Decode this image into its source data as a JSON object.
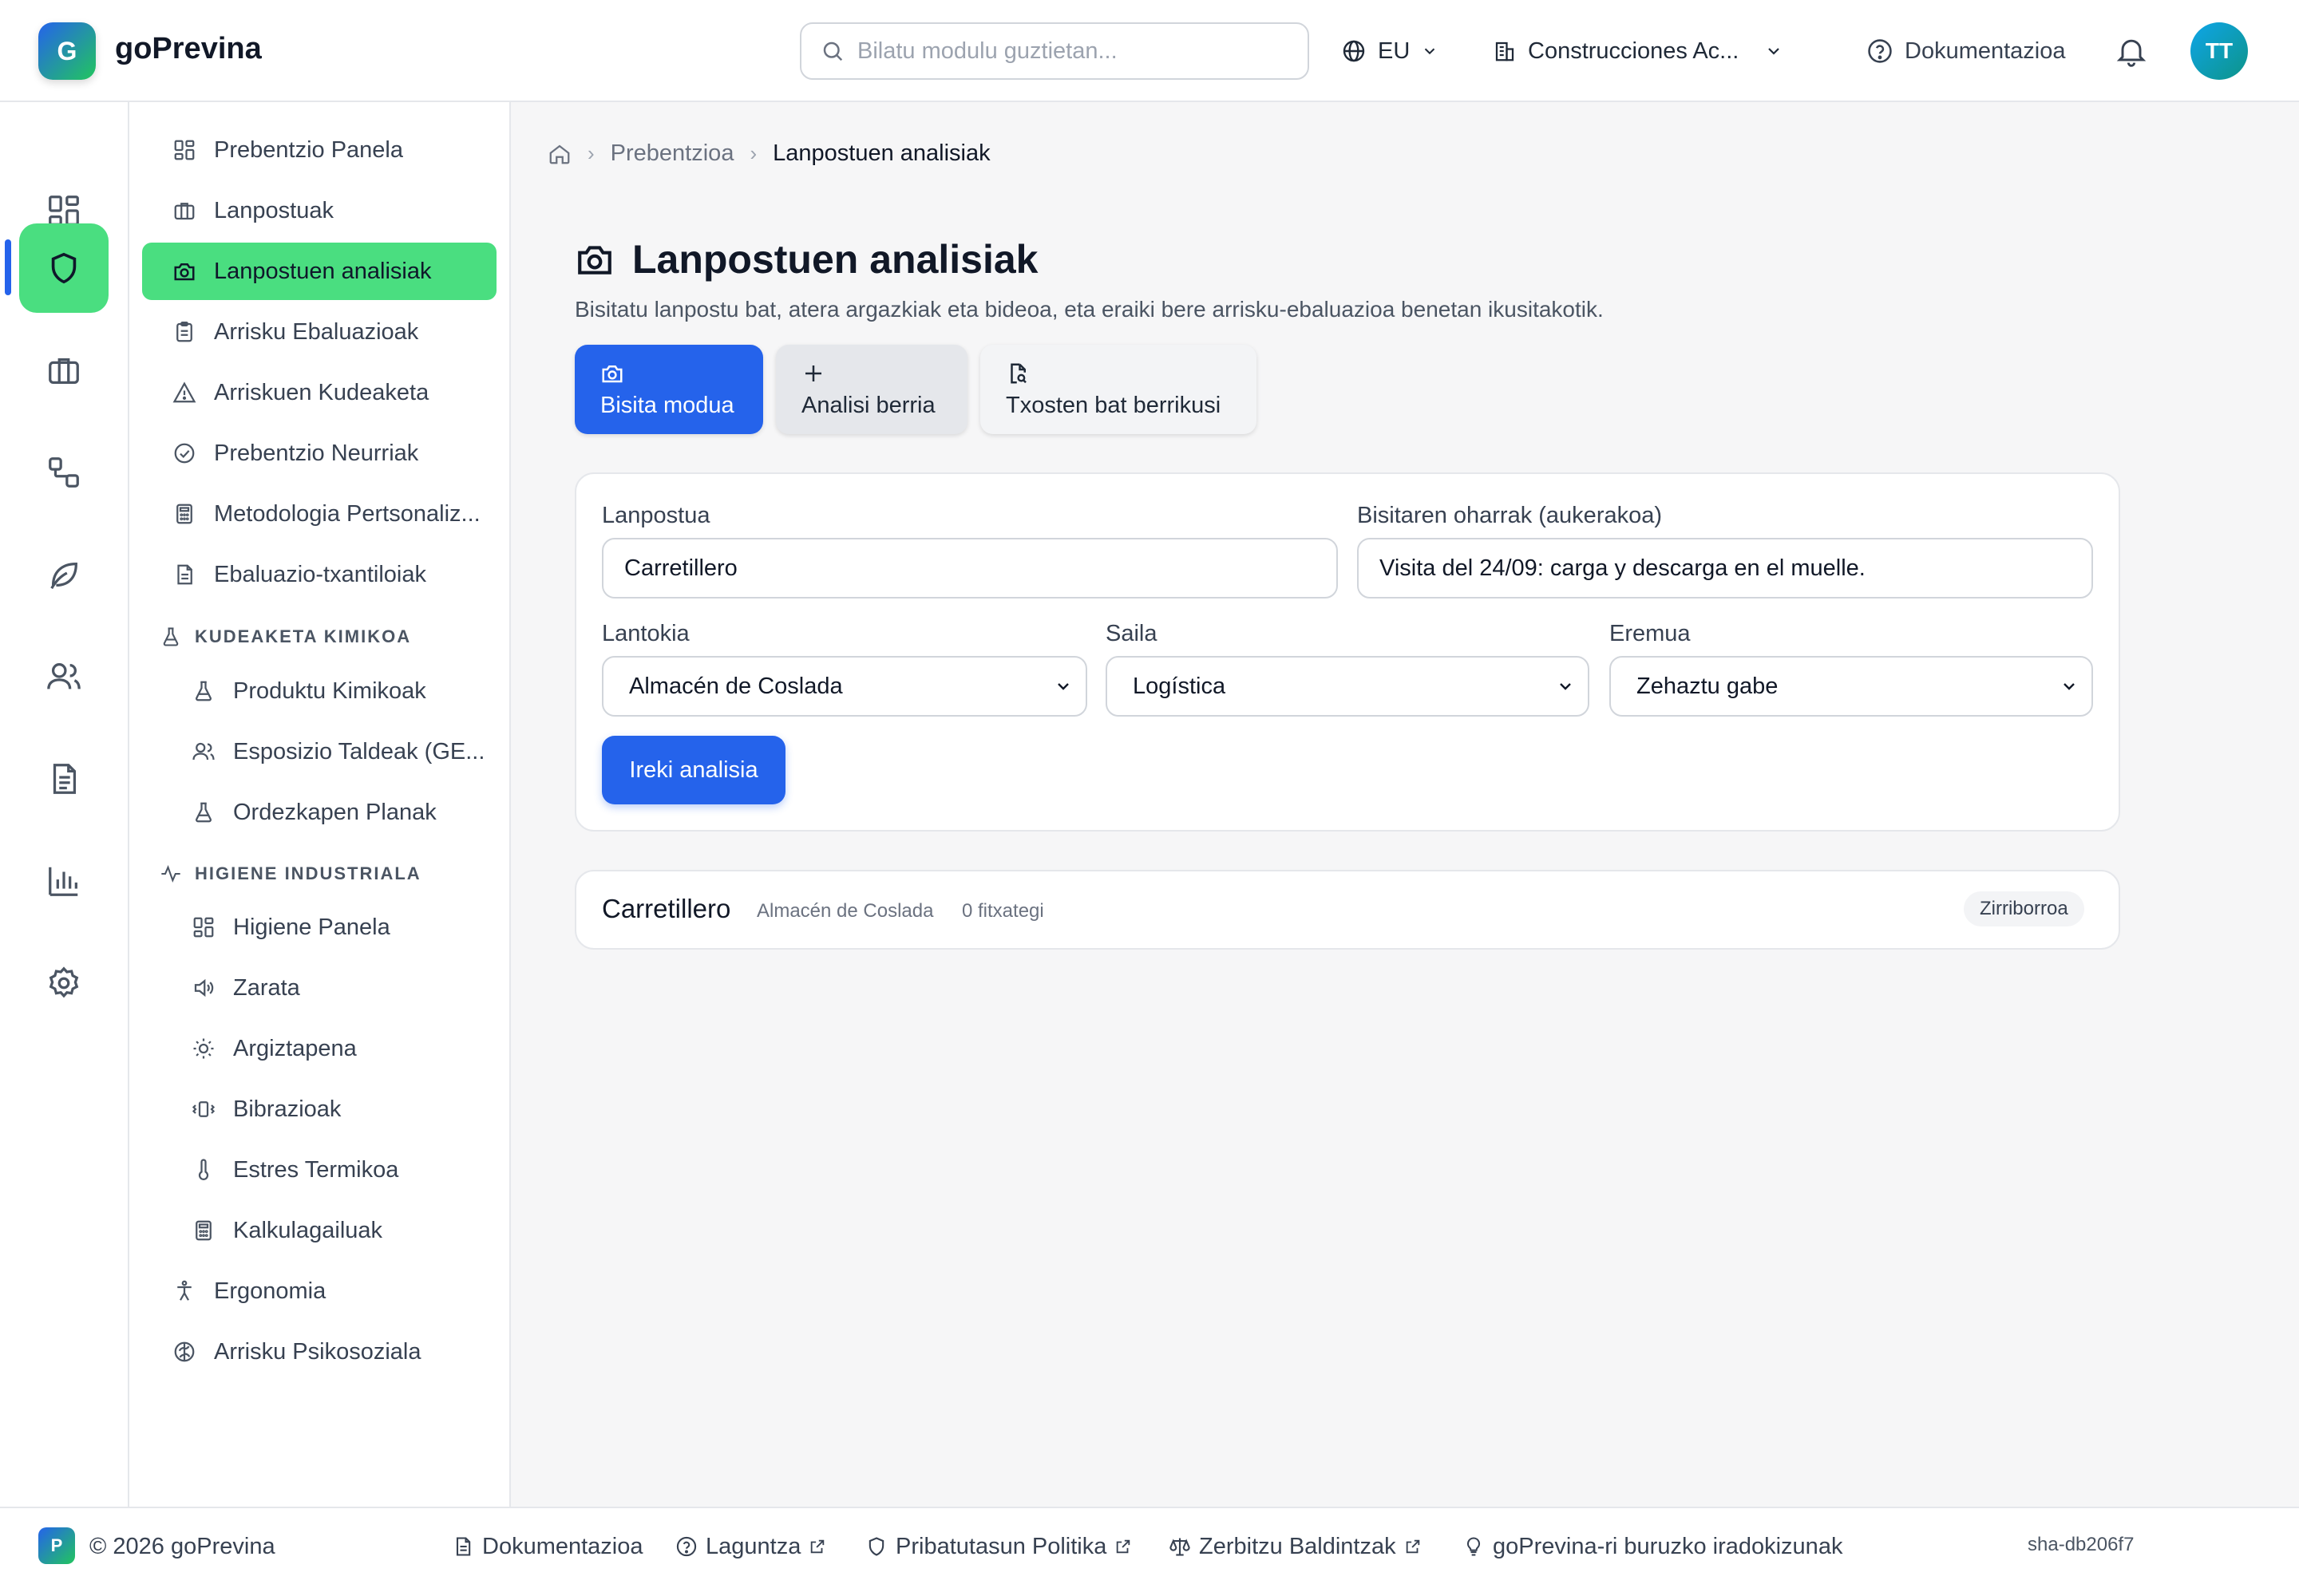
{
  "app": {
    "logo_letter": "G",
    "name": "goPrevina"
  },
  "header": {
    "search_placeholder": "Bilatu modulu guztietan...",
    "language": "EU",
    "company": "Construcciones Ac...",
    "docs": "Dokumentazioa",
    "avatar_initials": "TT"
  },
  "rail": {
    "items": [
      {
        "icon": "dashboard-icon"
      },
      {
        "icon": "shield-icon",
        "active": true
      },
      {
        "icon": "briefcase-icon"
      },
      {
        "icon": "workflow-icon"
      },
      {
        "icon": "leaf-icon"
      },
      {
        "icon": "users-icon"
      },
      {
        "icon": "document-icon"
      },
      {
        "icon": "bar-chart-icon"
      },
      {
        "icon": "gear-icon"
      }
    ]
  },
  "sidebar": {
    "items": [
      {
        "label": "Prebentzio Panela",
        "icon": "dashboard-icon"
      },
      {
        "label": "Lanpostuak",
        "icon": "briefcase-icon"
      },
      {
        "label": "Lanpostuen analisiak",
        "icon": "camera-icon",
        "active": true
      },
      {
        "label": "Arrisku Ebaluazioak",
        "icon": "clipboard-icon"
      },
      {
        "label": "Arriskuen Kudeaketa",
        "icon": "warning-icon"
      },
      {
        "label": "Prebentzio Neurriak",
        "icon": "check-circle-icon"
      },
      {
        "label": "Metodologia Pertsonaliz...",
        "icon": "calculator-icon"
      },
      {
        "label": "Ebaluazio-txantiloiak",
        "icon": "file-text-icon"
      }
    ],
    "section_chemical": {
      "title": "KUDEAKETA KIMIKOA",
      "items": [
        {
          "label": "Produktu Kimikoak",
          "icon": "flask-icon"
        },
        {
          "label": "Esposizio Taldeak (GE...",
          "icon": "users-icon"
        },
        {
          "label": "Ordezkapen Planak",
          "icon": "flask-icon"
        }
      ]
    },
    "section_hygiene": {
      "title": "HIGIENE INDUSTRIALA",
      "items": [
        {
          "label": "Higiene Panela",
          "icon": "dashboard-icon"
        },
        {
          "label": "Zarata",
          "icon": "speaker-icon"
        },
        {
          "label": "Argiztapena",
          "icon": "sun-icon"
        },
        {
          "label": "Bibrazioak",
          "icon": "vibration-icon"
        },
        {
          "label": "Estres Termikoa",
          "icon": "thermometer-icon"
        },
        {
          "label": "Kalkulagailuak",
          "icon": "calculator-icon"
        }
      ]
    },
    "bottom_items": [
      {
        "label": "Ergonomia",
        "icon": "person-icon"
      },
      {
        "label": "Arrisku Psikosoziala",
        "icon": "brain-icon"
      }
    ]
  },
  "breadcrumb": {
    "parent": "Prebentzioa",
    "current": "Lanpostuen analisiak"
  },
  "page": {
    "title": "Lanpostuen analisiak",
    "subtitle": "Bisitatu lanpostu bat, atera argazkiak eta bideoa, eta eraiki bere arrisku-ebaluazioa benetan ikusitakotik."
  },
  "tabs": [
    {
      "label": "Bisita modua",
      "icon": "camera-icon",
      "active": true
    },
    {
      "label": "Analisi berria",
      "icon": "plus-icon"
    },
    {
      "label": "Txosten bat berrikusi",
      "icon": "file-search-icon"
    }
  ],
  "form": {
    "lanpostua_label": "Lanpostua",
    "lanpostua_value": "Carretillero",
    "notes_label": "Bisitaren oharrak (aukerakoa)",
    "notes_value": "Visita del 24/09: carga y descarga en el muelle.",
    "lantokia_label": "Lantokia",
    "lantokia_value": "Almacén de Coslada",
    "saila_label": "Saila",
    "saila_value": "Logística",
    "eremua_label": "Eremua",
    "eremua_value": "Zehaztu gabe",
    "submit": "Ireki analisia"
  },
  "result": {
    "title": "Carretillero",
    "location": "Almacén de Coslada",
    "files": "0 fitxategi",
    "status": "Zirriborroa"
  },
  "footer": {
    "logo_letter": "P",
    "copyright": "© 2026 goPrevina",
    "docs": "Dokumentazioa",
    "help": "Laguntza",
    "privacy": "Pribatutasun Politika",
    "terms": "Zerbitzu Baldintzak",
    "suggestions": "goPrevina-ri buruzko iradokizunak",
    "sha": "sha-db206f7"
  },
  "colors": {
    "accent_blue": "#2563eb",
    "active_green": "#4ade80"
  }
}
